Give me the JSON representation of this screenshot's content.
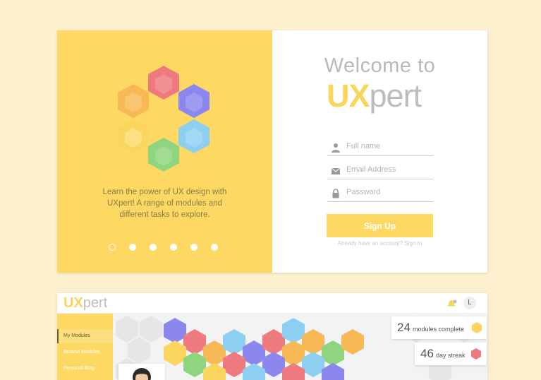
{
  "signup_card": {
    "tagline": "Learn the power of UX design with UXpert! A range of modules and different tasks to explore.",
    "carousel_dots": 6,
    "welcome": "Welcome to",
    "logo_ux": "UX",
    "logo_pert": "pert",
    "fields": {
      "full_name_placeholder": "Full name",
      "email_placeholder": "Email Address",
      "password_placeholder": "Password"
    },
    "signup_label": "Sign Up",
    "signin_text": "Already have an account? Sign In"
  },
  "dashboard": {
    "logo_ux": "UX",
    "logo_pert": "pert",
    "user_initial": "L",
    "sidebar": [
      {
        "label": "My Modules",
        "active": true
      },
      {
        "label": "Browse Modules",
        "active": false
      },
      {
        "label": "Personal Blog",
        "active": false
      }
    ],
    "stats": [
      {
        "number": "24",
        "label": "modules complete",
        "color": "#f9d45e"
      },
      {
        "number": "46",
        "label": "day streak",
        "color": "#ee7a7f"
      }
    ]
  },
  "colors": {
    "brand_yellow": "#fdd862",
    "background": "#fdf0cf",
    "hex_red": "#ee7a7f",
    "hex_purple": "#8b87ee",
    "hex_blue": "#8ccff0",
    "hex_green": "#8fd47e",
    "hex_orange": "#f7b955",
    "hex_yellow": "#fbd65e"
  }
}
